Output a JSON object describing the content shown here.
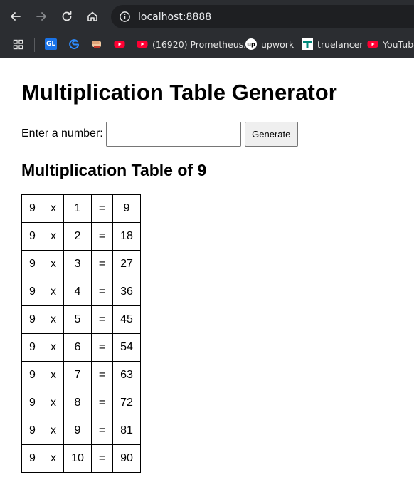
{
  "browser": {
    "url": "localhost:8888",
    "icons": {
      "back": "arrow-left-icon",
      "forward": "arrow-right-icon",
      "reload": "reload-icon",
      "home": "home-icon",
      "info": "info-icon"
    },
    "bookmarks": [
      {
        "label": "",
        "icon": "apps-grid-icon"
      },
      {
        "label": "",
        "icon": "gl-icon",
        "text_icon": "GL"
      },
      {
        "label": "",
        "icon": "edge-icon"
      },
      {
        "label": "",
        "icon": "fist-icon"
      },
      {
        "label": "",
        "icon": "youtube-icon"
      },
      {
        "label": "(16920) Prometheus...",
        "icon": "youtube-icon"
      },
      {
        "label": "upwork",
        "icon": "upwork-icon",
        "text_icon": "up"
      },
      {
        "label": "truelancer",
        "icon": "truelancer-icon"
      },
      {
        "label": "YouTube",
        "icon": "youtube-icon"
      }
    ]
  },
  "page": {
    "title": "Multiplication Table Generator",
    "form": {
      "label": "Enter a number:",
      "input_value": "",
      "button_label": "Generate"
    },
    "subtitle": "Multiplication Table of 9",
    "table": {
      "rows": [
        [
          "9",
          "x",
          "1",
          "=",
          "9"
        ],
        [
          "9",
          "x",
          "2",
          "=",
          "18"
        ],
        [
          "9",
          "x",
          "3",
          "=",
          "27"
        ],
        [
          "9",
          "x",
          "4",
          "=",
          "36"
        ],
        [
          "9",
          "x",
          "5",
          "=",
          "45"
        ],
        [
          "9",
          "x",
          "6",
          "=",
          "54"
        ],
        [
          "9",
          "x",
          "7",
          "=",
          "63"
        ],
        [
          "9",
          "x",
          "8",
          "=",
          "72"
        ],
        [
          "9",
          "x",
          "9",
          "=",
          "81"
        ],
        [
          "9",
          "x",
          "10",
          "=",
          "90"
        ]
      ]
    }
  },
  "colors": {
    "chrome_bg": "#2b2d31",
    "omnibox_bg": "#1e1f22",
    "youtube_red": "#ff0033",
    "gl_blue": "#1a73e8",
    "edge_blue": "#2d8cff"
  }
}
